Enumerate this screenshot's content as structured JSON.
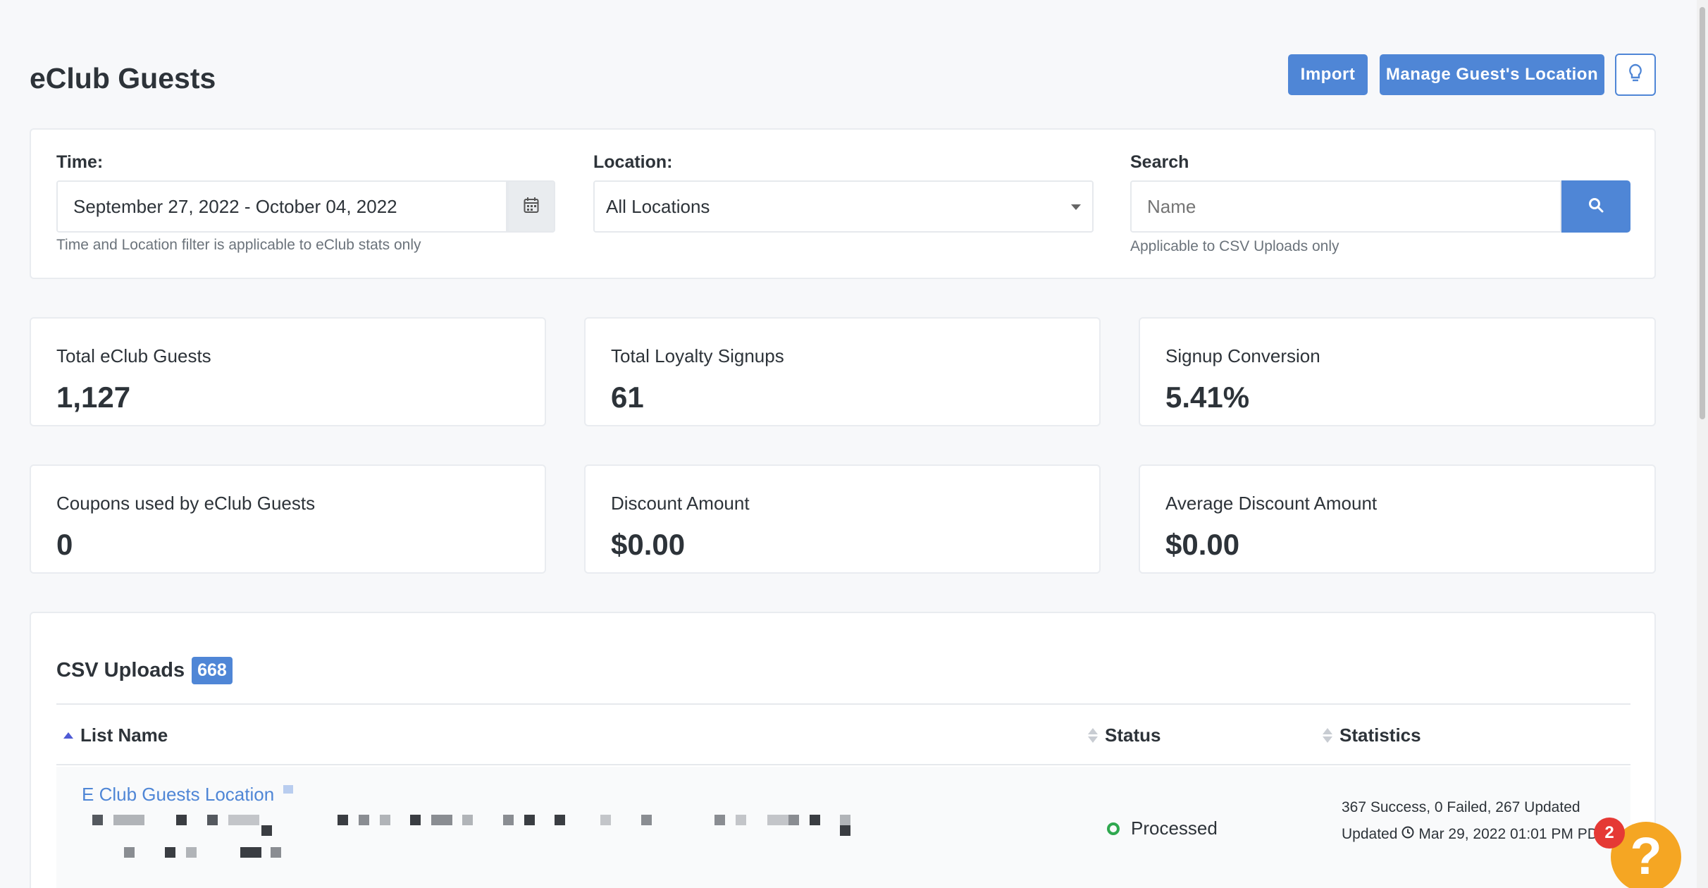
{
  "page": {
    "title": "eClub Guests"
  },
  "header_actions": {
    "import_label": "Import",
    "manage_location_label": "Manage Guest's Location",
    "tips_icon": "lightbulb-icon"
  },
  "filters": {
    "time": {
      "label": "Time:",
      "value": "September 27, 2022 - October 04, 2022",
      "help": "Time and Location filter is applicable to eClub stats only",
      "icon": "calendar-icon"
    },
    "location": {
      "label": "Location:",
      "value": "All Locations"
    },
    "search": {
      "label": "Search",
      "placeholder": "Name",
      "help": "Applicable to CSV Uploads only",
      "icon": "search-icon"
    }
  },
  "stats": [
    {
      "label": "Total eClub Guests",
      "value": "1,127"
    },
    {
      "label": "Total Loyalty Signups",
      "value": "61"
    },
    {
      "label": "Signup Conversion",
      "value": "5.41%"
    },
    {
      "label": "Coupons used by eClub Guests",
      "value": "0"
    },
    {
      "label": "Discount Amount",
      "value": "$0.00"
    },
    {
      "label": "Average Discount Amount",
      "value": "$0.00"
    }
  ],
  "csv_uploads": {
    "title": "CSV Uploads",
    "count": "668",
    "columns": {
      "list_name": "List Name",
      "status": "Status",
      "statistics": "Statistics"
    },
    "rows": [
      {
        "list_name": "E Club Guests Location",
        "status": "Processed",
        "stats_line": "367 Success, 0 Failed, 267 Updated",
        "updated_prefix": "Updated",
        "updated_at": "Mar 29, 2022 01:01 PM PD"
      }
    ]
  },
  "help_widget": {
    "label": "?",
    "badge": "2"
  },
  "colors": {
    "accent": "#4f86d6",
    "success": "#2fa84f",
    "help": "#f5a623",
    "alert": "#e53935"
  }
}
